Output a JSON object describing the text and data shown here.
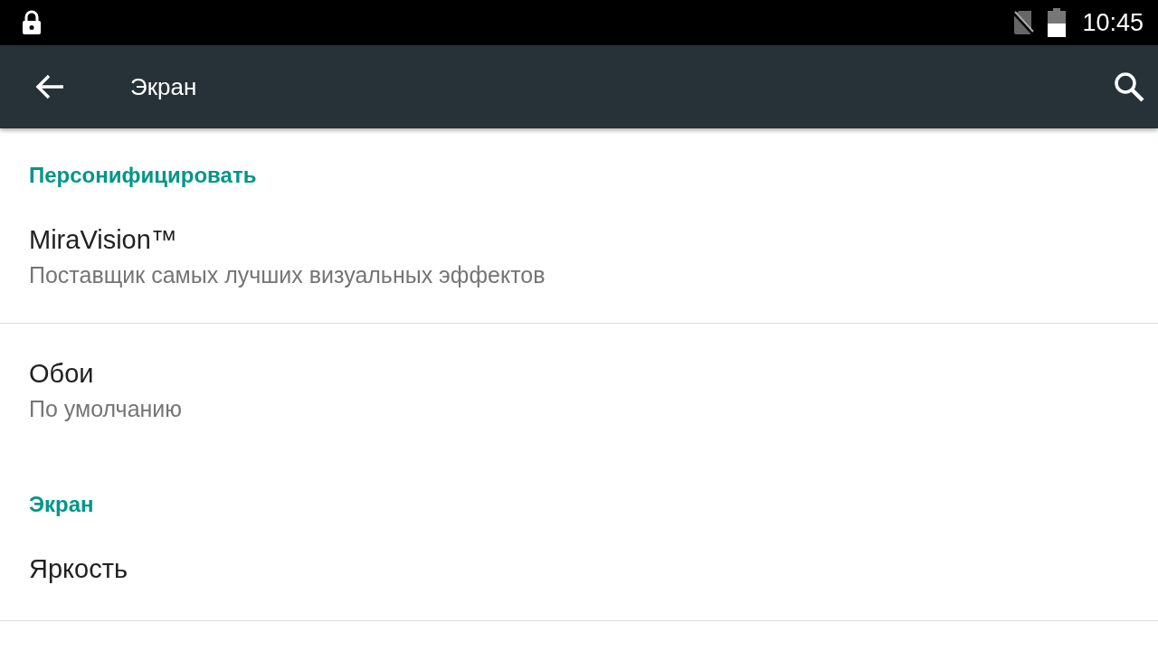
{
  "status_bar": {
    "time": "10:45"
  },
  "toolbar": {
    "title": "Экран"
  },
  "sections": [
    {
      "header": "Персонифицировать",
      "items": [
        {
          "title": "MiraVision™",
          "summary": "Поставщик самых лучших визуальных эффектов",
          "divider": true
        },
        {
          "title": "Обои",
          "summary": "По умолчанию",
          "divider": false
        }
      ]
    },
    {
      "header": "Экран",
      "items": [
        {
          "title": "Яркость",
          "divider": true
        }
      ]
    }
  ]
}
